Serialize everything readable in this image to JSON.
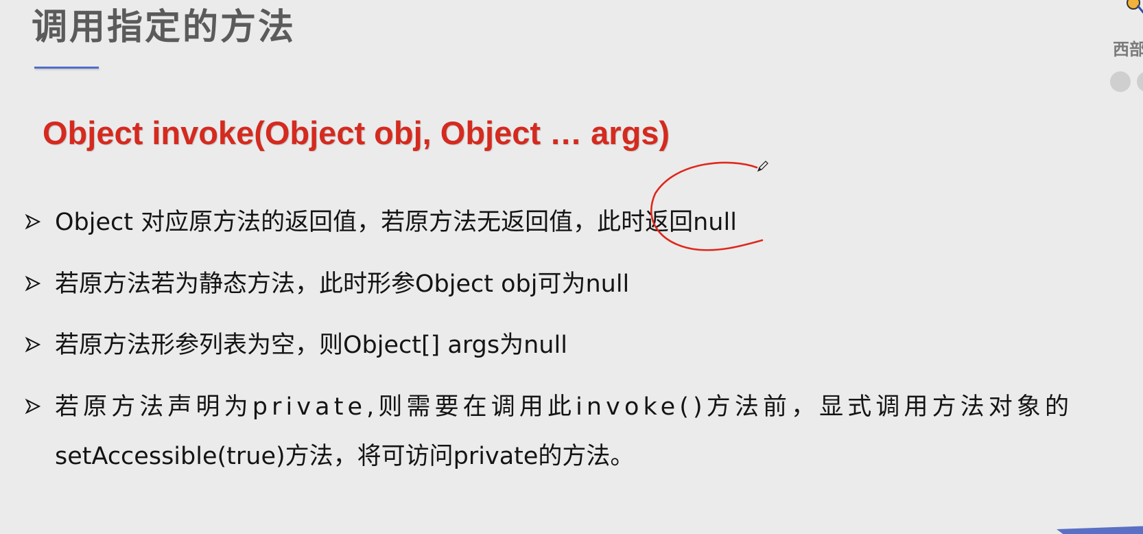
{
  "slide": {
    "title": "调用指定的方法",
    "signature": "Object invoke(Object obj, Object …  args)",
    "bullets": [
      "Object 对应原方法的返回值，若原方法无返回值，此时返回null",
      "若原方法若为静态方法，此时形参Object obj可为null",
      "若原方法形参列表为空，则Object[] args为null",
      "若原方法声明为private,则需要在调用此invoke()方法前，显式调用方法对象的"
    ],
    "bullet_continuation": "setAccessible(true)方法，将可访问private的方法。",
    "side_brand_text": "西部",
    "colors": {
      "title": "#5b5b5b",
      "signature": "#d52a1f",
      "accent_underline": "#4f6ec9",
      "annotation": "#e0271c",
      "background": "#ebebeb"
    },
    "icons": [
      "bullet-arrow-icon",
      "pen-cursor-icon",
      "brand-logo-icon"
    ]
  }
}
